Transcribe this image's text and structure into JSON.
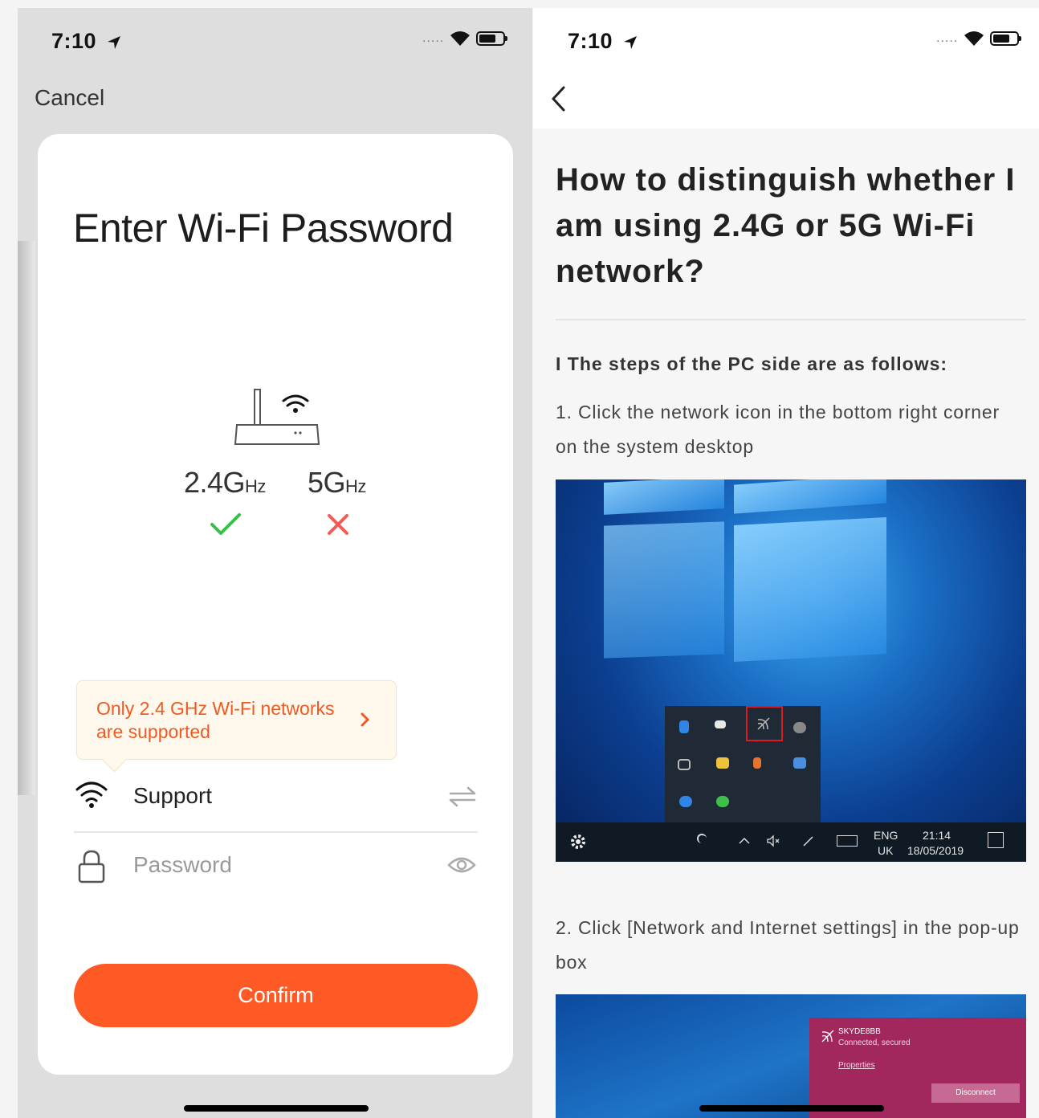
{
  "left_screen": {
    "status_bar": {
      "time": "7:10",
      "signal_dots": "....."
    },
    "header": {
      "cancel_label": "Cancel"
    },
    "card": {
      "title": "Enter Wi-Fi Password",
      "band_24_main": "2.4G",
      "band_24_unit": "Hz",
      "band_5_main": "5G",
      "band_5_unit": "Hz",
      "note_text": "Only 2.4 GHz Wi-Fi networks are supported",
      "ssid_value": "Support",
      "password_placeholder": "Password",
      "confirm_label": "Confirm"
    },
    "colors": {
      "accent": "#ff5a26",
      "check": "#35c04a",
      "cross": "#f35b55",
      "note_bg": "#fef9ec"
    }
  },
  "right_screen": {
    "status_bar": {
      "time": "7:10",
      "signal_dots": "....."
    },
    "article": {
      "title": "How to distinguish whether I am using 2.4G or 5G Wi-Fi network?",
      "subhead": "I The steps of the PC side are as follows:",
      "step1": "1. Click the network icon in the bottom right corner on the system desktop",
      "step2": "2. Click [Network and Internet settings] in the pop-up box"
    },
    "screenshot1": {
      "lang_top": "ENG",
      "lang_bottom": "UK",
      "clock_time": "21:14",
      "clock_date": "18/05/2019"
    },
    "screenshot2": {
      "ssid": "SKYDE8BB",
      "state": "Connected, secured",
      "properties": "Properties",
      "disconnect": "Disconnect"
    }
  }
}
